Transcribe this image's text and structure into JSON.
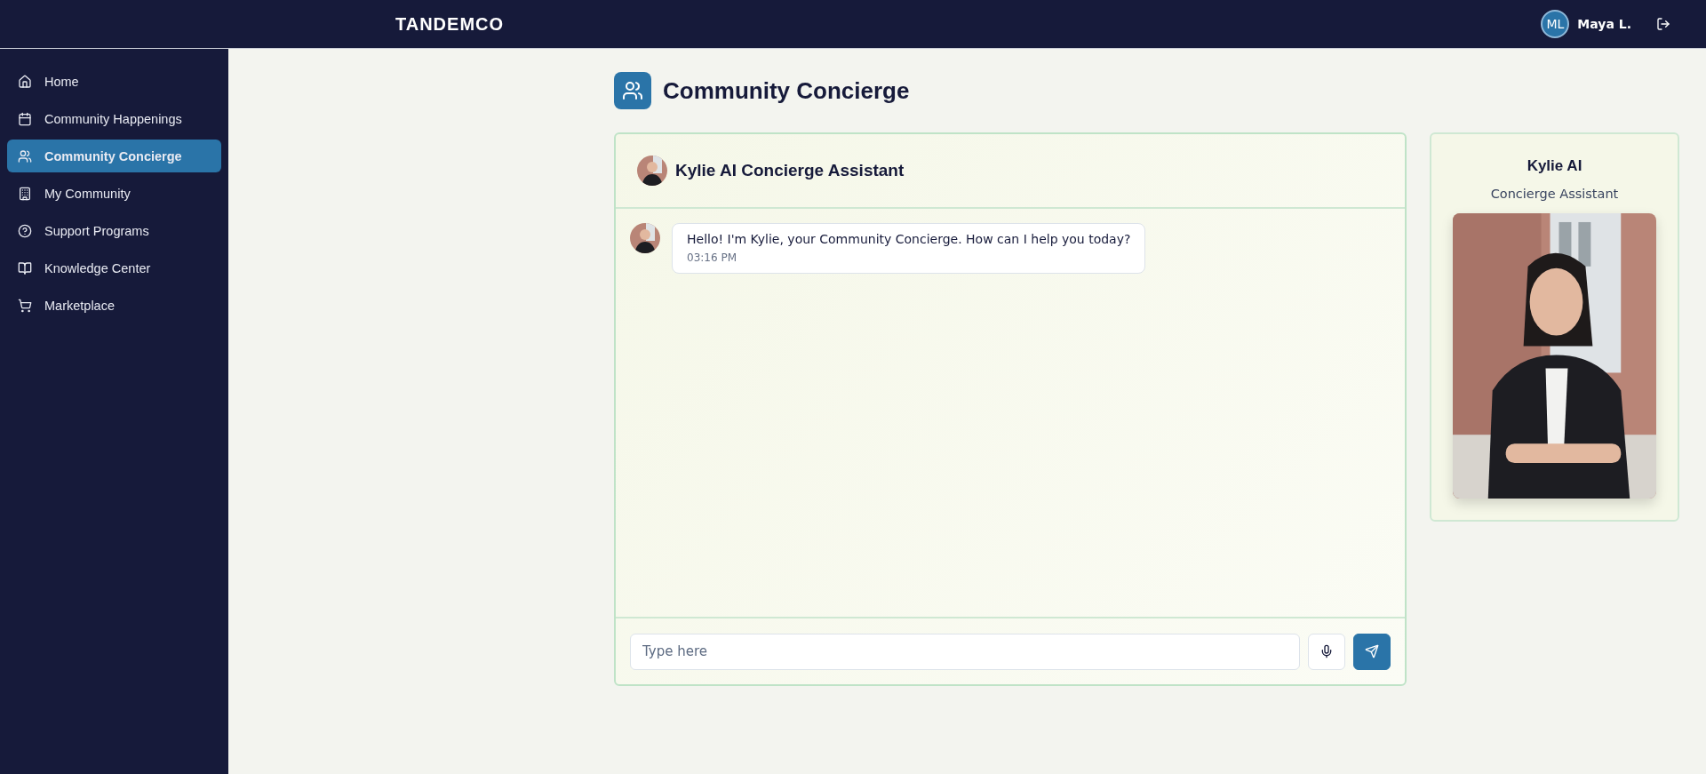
{
  "topbar": {
    "logo": "TANDEMCO",
    "user": {
      "initials": "ML",
      "name": "Maya L."
    }
  },
  "sidebar": {
    "items": [
      {
        "label": "Home",
        "selected": false
      },
      {
        "label": "Community Happenings",
        "selected": false
      },
      {
        "label": "Community Concierge",
        "selected": true
      },
      {
        "label": "My Community",
        "selected": false
      },
      {
        "label": "Support Programs",
        "selected": false
      },
      {
        "label": "Knowledge Center",
        "selected": false
      },
      {
        "label": "Marketplace",
        "selected": false
      }
    ]
  },
  "page": {
    "title": "Community Concierge"
  },
  "chat": {
    "title": "Kylie AI Concierge Assistant",
    "messages": [
      {
        "text": "Hello! I'm Kylie, your Community Concierge. How can I help you today?",
        "time": "03:16 PM"
      }
    ],
    "input": {
      "placeholder": "Type here"
    }
  },
  "profile": {
    "name": "Kylie AI",
    "role": "Concierge Assistant"
  }
}
